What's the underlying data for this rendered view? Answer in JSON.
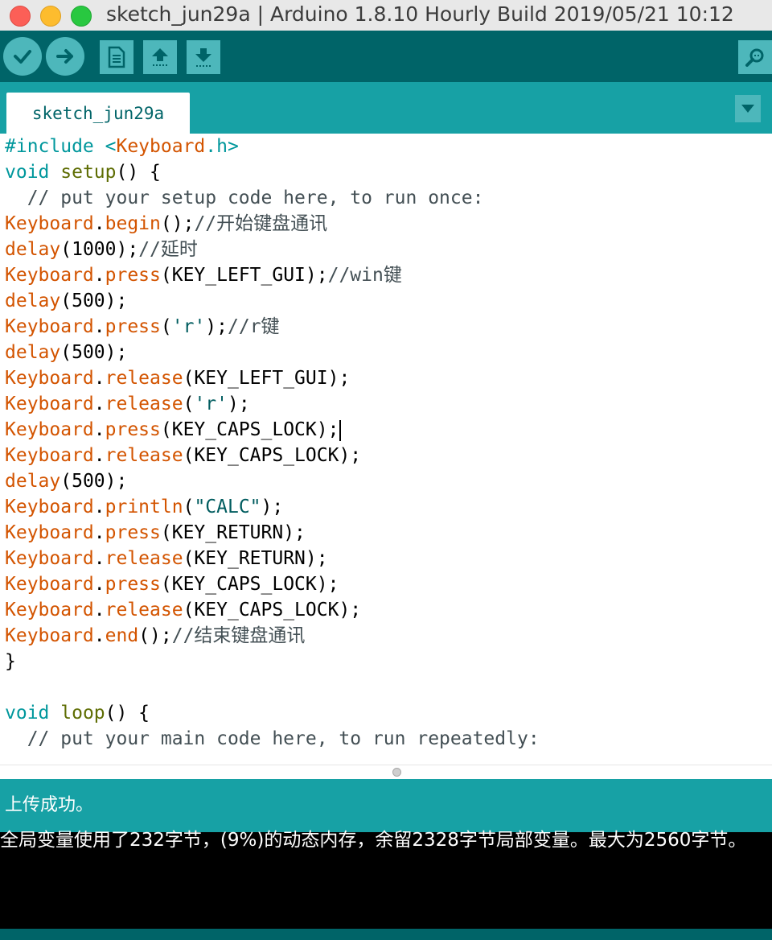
{
  "window": {
    "title": "sketch_jun29a | Arduino 1.8.10 Hourly Build 2019/05/21 10:12"
  },
  "toolbar": {
    "buttons": [
      {
        "name": "verify",
        "icon": "checkmark-icon"
      },
      {
        "name": "upload",
        "icon": "arrow-right-icon"
      },
      {
        "name": "new",
        "icon": "new-file-icon"
      },
      {
        "name": "open",
        "icon": "open-arrow-up-icon"
      },
      {
        "name": "save",
        "icon": "save-arrow-down-icon"
      },
      {
        "name": "serial-monitor",
        "icon": "magnifier-icon"
      }
    ]
  },
  "tabs": {
    "active": "sketch_jun29a",
    "menu_icon": "triangle-down-icon"
  },
  "editor": {
    "lines": [
      [
        {
          "t": "#include <",
          "c": "kw"
        },
        {
          "t": "Keyboard",
          "c": "cls"
        },
        {
          "t": ".h>",
          "c": "kw"
        }
      ],
      [
        {
          "t": "void",
          "c": "kw"
        },
        {
          "t": " "
        },
        {
          "t": "setup",
          "c": "fn"
        },
        {
          "t": "() {"
        }
      ],
      [
        {
          "t": "  // put your setup code here, to run once:",
          "c": "cm"
        }
      ],
      [
        {
          "t": "Keyboard",
          "c": "cls"
        },
        {
          "t": "."
        },
        {
          "t": "begin",
          "c": "cls"
        },
        {
          "t": "();"
        },
        {
          "t": "//开始键盘通讯",
          "c": "cm"
        }
      ],
      [
        {
          "t": "delay",
          "c": "cls"
        },
        {
          "t": "(1000);"
        },
        {
          "t": "//延时",
          "c": "cm"
        }
      ],
      [
        {
          "t": "Keyboard",
          "c": "cls"
        },
        {
          "t": "."
        },
        {
          "t": "press",
          "c": "cls"
        },
        {
          "t": "(KEY_LEFT_GUI);"
        },
        {
          "t": "//win键",
          "c": "cm"
        }
      ],
      [
        {
          "t": "delay",
          "c": "cls"
        },
        {
          "t": "(500);"
        }
      ],
      [
        {
          "t": "Keyboard",
          "c": "cls"
        },
        {
          "t": "."
        },
        {
          "t": "press",
          "c": "cls"
        },
        {
          "t": "("
        },
        {
          "t": "'r'",
          "c": "str"
        },
        {
          "t": ");"
        },
        {
          "t": "//r键",
          "c": "cm"
        }
      ],
      [
        {
          "t": "delay",
          "c": "cls"
        },
        {
          "t": "(500);"
        }
      ],
      [
        {
          "t": "Keyboard",
          "c": "cls"
        },
        {
          "t": "."
        },
        {
          "t": "release",
          "c": "cls"
        },
        {
          "t": "(KEY_LEFT_GUI);"
        }
      ],
      [
        {
          "t": "Keyboard",
          "c": "cls"
        },
        {
          "t": "."
        },
        {
          "t": "release",
          "c": "cls"
        },
        {
          "t": "("
        },
        {
          "t": "'r'",
          "c": "str"
        },
        {
          "t": ");"
        }
      ],
      [
        {
          "t": "Keyboard",
          "c": "cls"
        },
        {
          "t": "."
        },
        {
          "t": "press",
          "c": "cls"
        },
        {
          "t": "(KEY_CAPS_LOCK);"
        },
        {
          "caret": true
        }
      ],
      [
        {
          "t": "Keyboard",
          "c": "cls"
        },
        {
          "t": "."
        },
        {
          "t": "release",
          "c": "cls"
        },
        {
          "t": "(KEY_CAPS_LOCK);"
        }
      ],
      [
        {
          "t": "delay",
          "c": "cls"
        },
        {
          "t": "(500);"
        }
      ],
      [
        {
          "t": "Keyboard",
          "c": "cls"
        },
        {
          "t": "."
        },
        {
          "t": "println",
          "c": "cls"
        },
        {
          "t": "("
        },
        {
          "t": "\"CALC\"",
          "c": "str"
        },
        {
          "t": ");"
        }
      ],
      [
        {
          "t": "Keyboard",
          "c": "cls"
        },
        {
          "t": "."
        },
        {
          "t": "press",
          "c": "cls"
        },
        {
          "t": "(KEY_RETURN);"
        }
      ],
      [
        {
          "t": "Keyboard",
          "c": "cls"
        },
        {
          "t": "."
        },
        {
          "t": "release",
          "c": "cls"
        },
        {
          "t": "(KEY_RETURN);"
        }
      ],
      [
        {
          "t": "Keyboard",
          "c": "cls"
        },
        {
          "t": "."
        },
        {
          "t": "press",
          "c": "cls"
        },
        {
          "t": "(KEY_CAPS_LOCK);"
        }
      ],
      [
        {
          "t": "Keyboard",
          "c": "cls"
        },
        {
          "t": "."
        },
        {
          "t": "release",
          "c": "cls"
        },
        {
          "t": "(KEY_CAPS_LOCK);"
        }
      ],
      [
        {
          "t": "Keyboard",
          "c": "cls"
        },
        {
          "t": "."
        },
        {
          "t": "end",
          "c": "cls"
        },
        {
          "t": "();"
        },
        {
          "t": "//结束键盘通讯",
          "c": "cm"
        }
      ],
      [
        {
          "t": "}"
        }
      ],
      [
        {
          "t": ""
        }
      ],
      [
        {
          "t": "void",
          "c": "kw"
        },
        {
          "t": " "
        },
        {
          "t": "loop",
          "c": "fn"
        },
        {
          "t": "() {"
        }
      ],
      [
        {
          "t": "  // put your main code here, to run repeatedly:",
          "c": "cm"
        }
      ]
    ]
  },
  "status": {
    "message": "上传成功。"
  },
  "console": {
    "output": "全局变量使用了232字节，(9%)的动态内存，余留2328字节局部变量。最大为2560字节。"
  },
  "colors": {
    "toolbar": "#006468",
    "tabstrip": "#17a1a5",
    "button": "#4db7bb",
    "keyword": "#00979c",
    "function": "#5e6d03",
    "class": "#d35400",
    "comment": "#434f54"
  }
}
